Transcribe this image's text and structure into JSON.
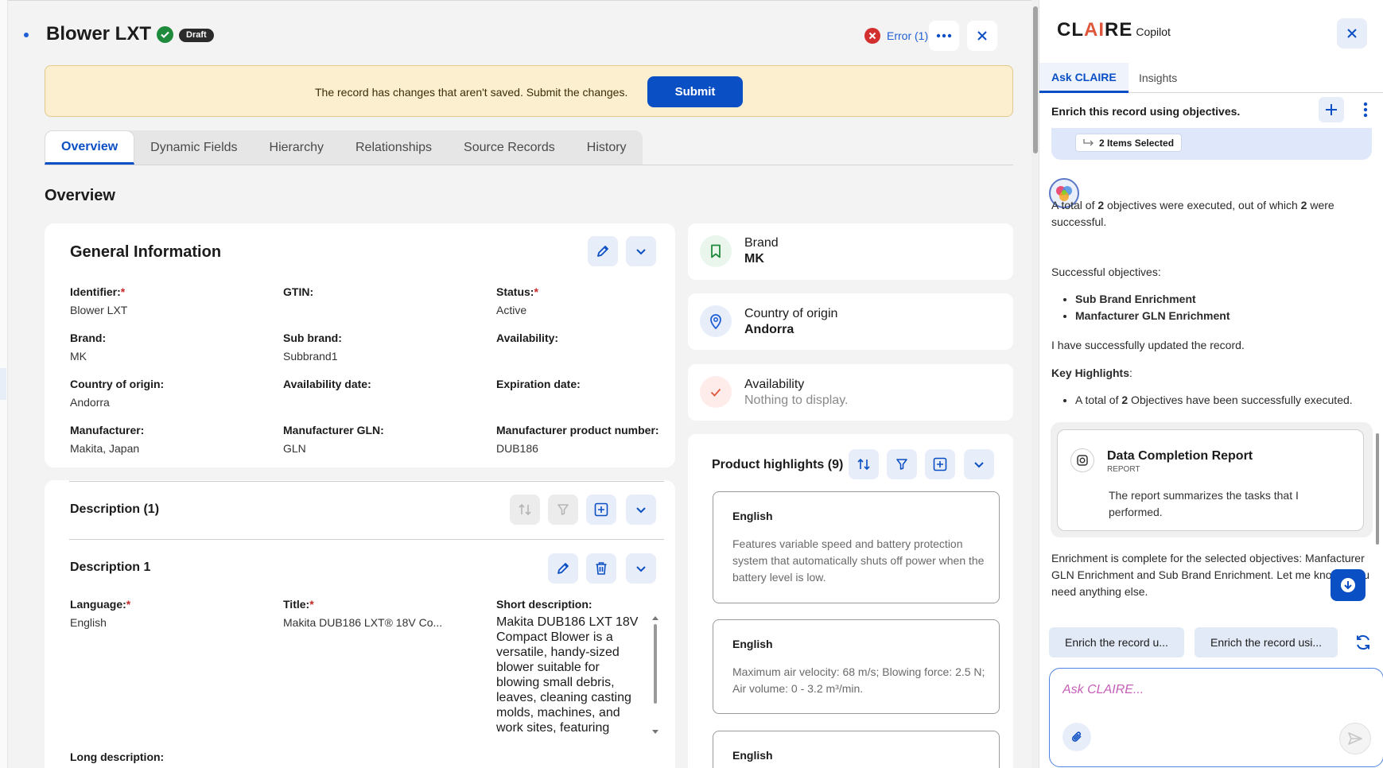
{
  "header": {
    "title": "Blower LXT",
    "status_badge": "Draft",
    "error_label": "Error (1)"
  },
  "banner": {
    "message": "The record has changes that aren't saved. Submit the changes.",
    "submit_label": "Submit"
  },
  "tabs": [
    {
      "label": "Overview",
      "active": true
    },
    {
      "label": "Dynamic Fields"
    },
    {
      "label": "Hierarchy"
    },
    {
      "label": "Relationships"
    },
    {
      "label": "Source Records"
    },
    {
      "label": "History"
    }
  ],
  "section_title": "Overview",
  "general_info": {
    "title": "General Information",
    "fields": [
      {
        "label": "Identifier:",
        "required": true,
        "value": "Blower LXT"
      },
      {
        "label": "GTIN:",
        "required": false,
        "value": ""
      },
      {
        "label": "Status:",
        "required": true,
        "value": "Active"
      },
      {
        "label": "Brand:",
        "required": false,
        "value": "MK"
      },
      {
        "label": "Sub brand:",
        "required": false,
        "value": "Subbrand1"
      },
      {
        "label": "Availability:",
        "required": false,
        "value": ""
      },
      {
        "label": "Country of origin:",
        "required": false,
        "value": "Andorra"
      },
      {
        "label": "Availability date:",
        "required": false,
        "value": ""
      },
      {
        "label": "Expiration date:",
        "required": false,
        "value": ""
      },
      {
        "label": "Manufacturer:",
        "required": false,
        "value": "Makita, Japan"
      },
      {
        "label": "Manufacturer GLN:",
        "required": false,
        "value": "GLN"
      },
      {
        "label": "Manufacturer product number:",
        "required": false,
        "value": "DUB186"
      }
    ]
  },
  "description": {
    "title": "Description (1)",
    "item_title": "Description 1",
    "language_label": "Language:",
    "language_value": "English",
    "title_label": "Title:",
    "title_value": "Makita DUB186 LXT® 18V Co...",
    "short_label": "Short description:",
    "short_value": "Makita DUB186 LXT 18V Compact Blower is a versatile, handy-sized blower suitable for blowing small debris, leaves, cleaning casting molds, machines, and work sites, featuring variable speed",
    "long_label": "Long description:"
  },
  "summary_cards": [
    {
      "label": "Brand",
      "value": "MK",
      "icon": "bookmark-icon",
      "color": "#1e8a3c"
    },
    {
      "label": "Country of origin",
      "value": "Andorra",
      "icon": "location-pin-icon",
      "color": "#1f5fd6"
    },
    {
      "label": "Availability",
      "value": "Nothing to display.",
      "icon": "check-icon",
      "color": "#e0563b"
    }
  ],
  "highlights": {
    "title": "Product highlights (9)",
    "items": [
      {
        "language": "English",
        "text": "Features variable speed and battery protection system that automatically shuts off power when the battery level is low."
      },
      {
        "language": "English",
        "text": "Maximum air velocity: 68 m/s; Blowing force: 2.5 N; Air volume: 0 - 3.2 m³/min."
      },
      {
        "language": "English",
        "text": ""
      }
    ]
  },
  "copilot": {
    "logo_main_1": "CL",
    "logo_main_ai": "AI",
    "logo_main_2": "RE",
    "logo_sub": "Copilot",
    "tabs": [
      "Ask CLAIRE",
      "Insights"
    ],
    "subtitle": "Enrich this record using objectives.",
    "items_selected": "2 Items Selected",
    "msg_total_a": "A total of ",
    "msg_total_b": "2",
    "msg_total_c": " objectives were executed, out of which ",
    "msg_total_d": "2",
    "msg_total_e": " were successful.",
    "successful_label": "Successful objectives:",
    "objectives": [
      "Sub Brand Enrichment",
      "Manfacturer GLN Enrichment"
    ],
    "updated_msg": "I have successfully updated the record.",
    "highlights_label": "Key Highlights",
    "highlight_a": "A total of ",
    "highlight_b": "2",
    "highlight_c": " Objectives have been successfully executed.",
    "report_title": "Data Completion Report",
    "report_kind": "REPORT",
    "report_desc": "The report summarizes the tasks that I performed.",
    "completion_msg": "Enrichment is complete for the selected objectives: Manfacturer GLN Enrichment and Sub Brand Enrichment. Let me know if you need anything else.",
    "suggestions": [
      "Enrich the record u...",
      "Enrich the record usi..."
    ],
    "ask_placeholder": "Ask CLAIRE..."
  },
  "colors": {
    "accent": "#0b4fc4",
    "error": "#d32f2f",
    "success": "#1e8a3c",
    "banner_bg": "#fbefcf"
  }
}
